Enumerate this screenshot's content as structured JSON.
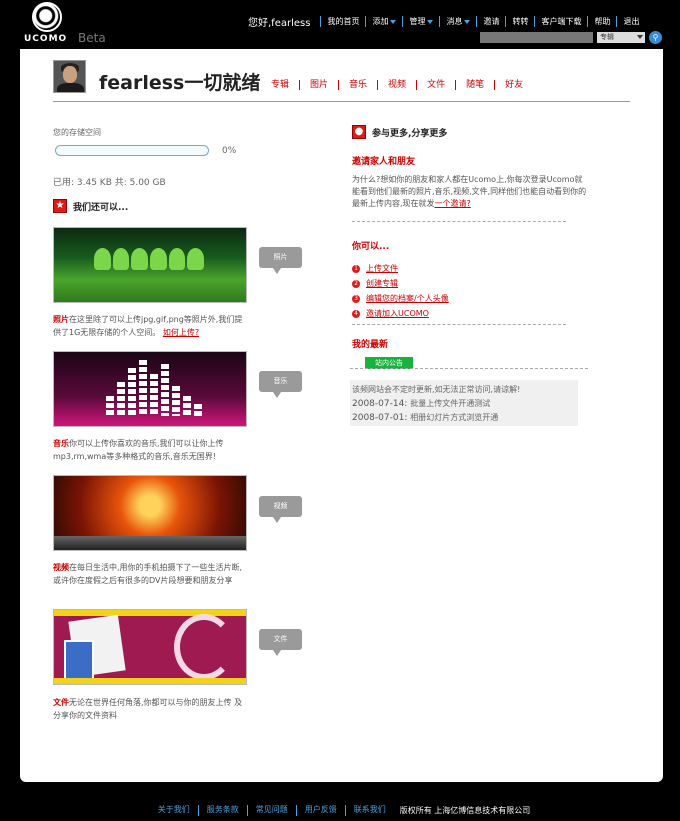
{
  "brand": {
    "logo_text": "UCOMO",
    "beta": "Beta"
  },
  "topnav": {
    "greeting": "您好,fearless",
    "items": [
      "我的首页",
      "添加",
      "管理",
      "消息",
      "邀请",
      "转转",
      "客户端下载",
      "帮助",
      "退出"
    ]
  },
  "search": {
    "scope": "专辑",
    "button_icon": "search-icon"
  },
  "profile": {
    "username": "fearless一切就绪",
    "tabs": [
      "专辑",
      "图片",
      "音乐",
      "视频",
      "文件",
      "随笔",
      "好友"
    ]
  },
  "storage": {
    "label": "您的存储空间",
    "percent": "0%",
    "fill_fraction": 0,
    "used_text": "已用: 3.45 KB 共: 5.00 GB"
  },
  "can_do": {
    "title": "我们还可以...",
    "features": [
      {
        "bubble": "照片",
        "keyword": "照片",
        "text": "在这里除了可以上传jpg,gif,png等照片外,我们提供了1G无限存储的个人空间。",
        "link": "如何上传?"
      },
      {
        "bubble": "音乐",
        "keyword": "音乐",
        "text": "你可以上传你喜欢的音乐,我们可以让你上传 mp3,rm,wma等多种格式的音乐,音乐无国界!",
        "link": ""
      },
      {
        "bubble": "视频",
        "keyword": "视频",
        "text": "在每日生活中,用你的手机拍摄下了一些生活片断,或许你在度假之后有很多的DV片段想要和朋友分享",
        "link": ""
      },
      {
        "bubble": "文件",
        "keyword": "文件",
        "text": "无论在世界任何角落,你都可以与你的朋友上传 及分享你的文件资料",
        "link": ""
      }
    ]
  },
  "right": {
    "more_title": "参与更多,分享更多",
    "invite_title": "邀请家人和朋友",
    "invite_text": "为什么?想如你的朋友和家人都在Ucomo上,你每次登录Ucomo就能看到他们最新的照片,音乐,视频,文件,同样他们也能自动看到你的最新上传内容,现在就发",
    "invite_link": "一个邀请?",
    "can_title": "你可以...",
    "actions": [
      "上传文件",
      "创建专辑",
      "编辑您的档案/个人头像",
      "邀请加入UCOMO"
    ],
    "latest_title": "我的最新",
    "news_tab": "站内公告",
    "news_notice": "该频网站会不定时更新,如无法正常访问,请谅解!",
    "news": [
      {
        "date": "2008-07-14",
        "text": "批量上传文件开通测试"
      },
      {
        "date": "2008-07-01",
        "text": "相册幻灯片方式浏览开通"
      }
    ]
  },
  "footer": {
    "links": [
      "关于我们",
      "服务条款",
      "常见问题",
      "用户反馈",
      "联系我们"
    ],
    "copyright": "版权所有 上海亿博信息技术有限公司"
  },
  "colors": {
    "accent_red": "#cc0000",
    "brand_blue": "#4aa3df",
    "news_green": "#17b43c"
  }
}
